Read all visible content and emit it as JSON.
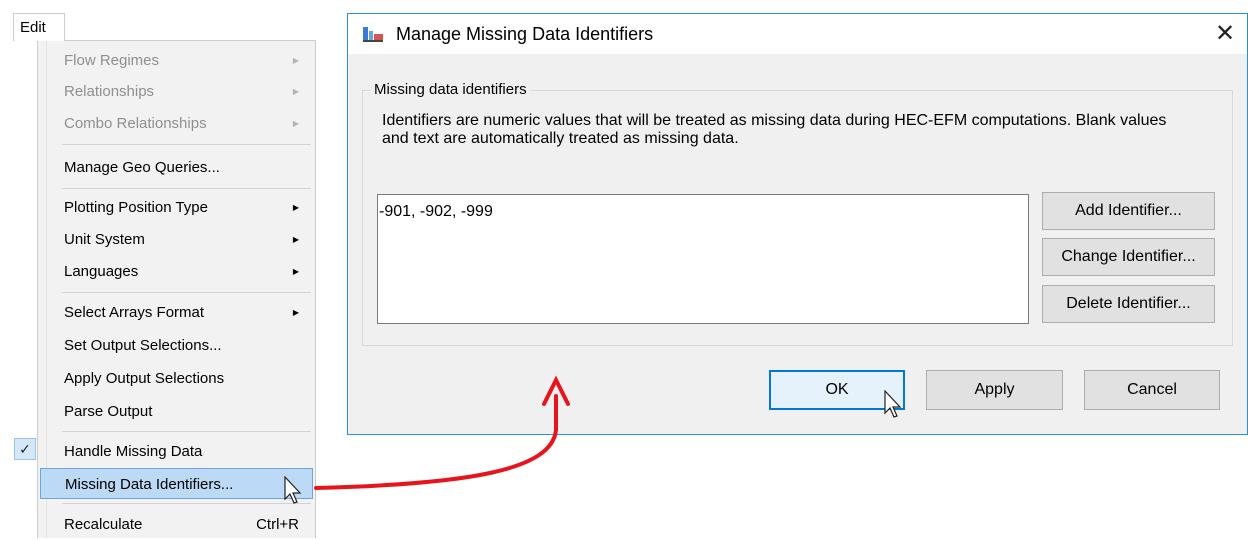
{
  "menubar": {
    "edit_label": "Edit"
  },
  "menu": {
    "items": [
      {
        "label": "Flow Regimes",
        "disabled": true,
        "submenu": true
      },
      {
        "label": "Relationships",
        "disabled": true,
        "submenu": true
      },
      {
        "label": "Combo Relationships",
        "disabled": true,
        "submenu": true
      },
      {
        "label": "Manage Geo Queries..."
      },
      {
        "label": "Plotting Position Type",
        "submenu": true
      },
      {
        "label": "Unit System",
        "submenu": true
      },
      {
        "label": "Languages",
        "submenu": true
      },
      {
        "label": "Select Arrays Format",
        "submenu": true
      },
      {
        "label": "Set Output Selections..."
      },
      {
        "label": "Apply Output Selections"
      },
      {
        "label": "Parse Output"
      },
      {
        "label": "Handle Missing Data",
        "checked": true
      },
      {
        "label": "Missing Data Identifiers...",
        "selected": true
      },
      {
        "label": "Recalculate",
        "shortcut": "Ctrl+R"
      }
    ],
    "check_glyph": "✓"
  },
  "dialog": {
    "title": "Manage Missing Data Identifiers",
    "close_glyph": "✕",
    "group_label": "Missing data identifiers",
    "description": "Identifiers are numeric values that will be treated as missing data during HEC-EFM computations.  Blank values and text are automatically treated as missing data.",
    "identifiers_value": "-901, -902, -999",
    "buttons": {
      "add": "Add Identifier...",
      "change": "Change Identifier...",
      "delete": "Delete Identifier...",
      "ok": "OK",
      "apply": "Apply",
      "cancel": "Cancel"
    }
  },
  "colors": {
    "annotation_arrow": "#e8141c",
    "focus_border": "#0078d7",
    "selection_bg": "#bcdaf5"
  },
  "icons": [
    "app-icon",
    "close-icon",
    "submenu-arrow-icon",
    "check-icon",
    "mouse-cursor-icon",
    "annotation-arrow"
  ]
}
